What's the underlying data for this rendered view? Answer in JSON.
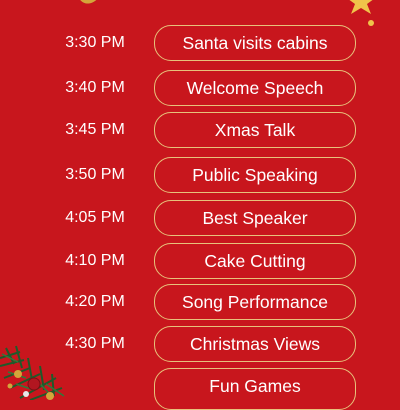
{
  "schedule": [
    {
      "time": "3:30 PM",
      "event": "Santa visits cabins"
    },
    {
      "time": "3:40 PM",
      "event": "Welcome Speech"
    },
    {
      "time": "3:45 PM",
      "event": "Xmas Talk"
    },
    {
      "time": "3:50 PM",
      "event": "Public Speaking"
    },
    {
      "time": "4:05 PM",
      "event": "Best Speaker"
    },
    {
      "time": "4:10 PM",
      "event": "Cake Cutting"
    },
    {
      "time": "4:20 PM",
      "event": "Song Performance"
    },
    {
      "time": "4:30 PM",
      "event": "Christmas Views"
    },
    {
      "time": "",
      "event": "Fun Games"
    }
  ],
  "colors": {
    "background": "#c8161d",
    "pill_border": "#e7c27b",
    "text": "#ffffff",
    "gold": "#f0c44a"
  },
  "decorations": [
    "ornament-icon",
    "star-icon",
    "christmas-garland-icon"
  ]
}
